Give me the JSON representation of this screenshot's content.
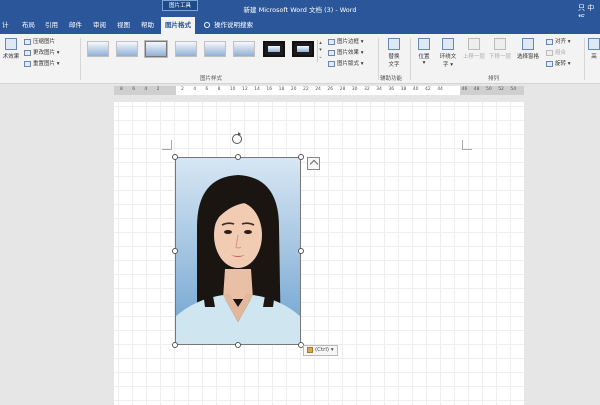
{
  "titlebar": {
    "context_tab": "图片工具",
    "doc_title": "新建 Microsoft Word 文档 (3) - Word",
    "user": "只 中枢"
  },
  "tabs": {
    "items": [
      "计",
      "布局",
      "引用",
      "邮件",
      "审阅",
      "视图",
      "帮助"
    ],
    "active": "图片格式",
    "tell_me": "操作说明搜索"
  },
  "ribbon": {
    "adjust_label": "术效果",
    "compress": "压缩图片",
    "change": "更改图片",
    "reset": "重置图片",
    "border": "图片边框",
    "effects": "图片效果",
    "layout": "图片版式",
    "picture_styles_label": "图片样式",
    "accessibility_label": "辅助功能",
    "alt_text_1": "替换",
    "alt_text_2": "文字",
    "position_1": "位置",
    "wrap_1": "环绕文",
    "wrap_2": "字",
    "forward": "上移一层",
    "backward": "下移一层",
    "selection_pane": "选择窗格",
    "align": "对齐",
    "group": "组合",
    "rotate": "旋转",
    "arrange_label": "排列",
    "size_label": "高"
  },
  "ruler": {
    "numbers": [
      "8",
      "6",
      "4",
      "2",
      "",
      "2",
      "4",
      "6",
      "8",
      "10",
      "12",
      "14",
      "16",
      "18",
      "20",
      "22",
      "24",
      "26",
      "28",
      "30",
      "32",
      "34",
      "36",
      "38",
      "40",
      "42",
      "44",
      "",
      "46",
      "48",
      "50",
      "52",
      "54"
    ]
  },
  "ctrl_button": "(Ctrl)"
}
